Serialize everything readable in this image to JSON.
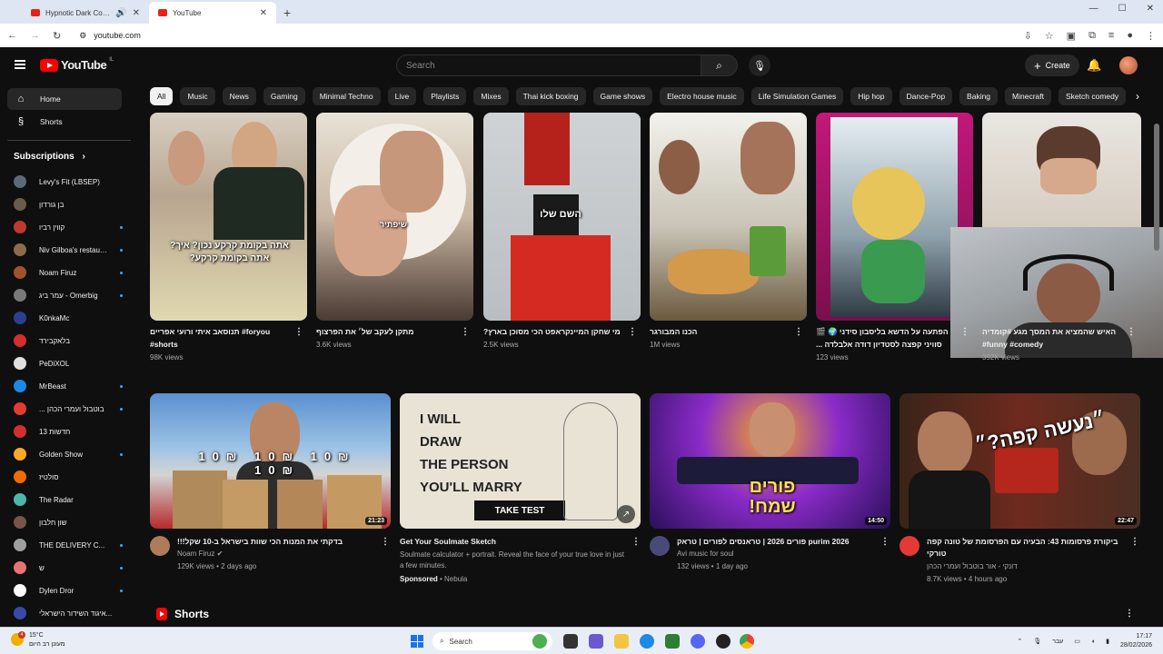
{
  "browser": {
    "tabs": [
      {
        "title": "Hypnotic Dark Code | Futur",
        "active": false
      },
      {
        "title": "YouTube",
        "active": true
      }
    ],
    "new_tab": "+",
    "url": "youtube.com"
  },
  "masthead": {
    "logo_text": "YouTube",
    "country_code": "IL",
    "search_placeholder": "Search",
    "create_label": "Create"
  },
  "sidebar": {
    "primary": [
      {
        "label": "Home",
        "icon": "home-icon"
      },
      {
        "label": "Shorts",
        "icon": "shorts-icon"
      }
    ],
    "subscriptions_title": "Subscriptions",
    "subscriptions": [
      {
        "name": "Levy's Fit (LBSEP)",
        "color": "#5a6a7a",
        "new": false
      },
      {
        "name": "בן גורדון",
        "color": "#6b5b4b",
        "new": false
      },
      {
        "name": "קווין רביו",
        "color": "#c0392b",
        "new": true
      },
      {
        "name": "Niv Gilboa's restaur...",
        "color": "#8e6b4b",
        "new": true
      },
      {
        "name": "Noam Firuz",
        "color": "#a0522d",
        "new": true
      },
      {
        "name": "עמר ביג - Omerbig",
        "color": "#7a7a7a",
        "new": true
      },
      {
        "name": "K0nkaMc",
        "color": "#2c3e8f",
        "new": false
      },
      {
        "name": "בלאקבירד",
        "color": "#d32f2f",
        "new": false
      },
      {
        "name": "PeDiXOL",
        "color": "#e0e0e0",
        "new": false
      },
      {
        "name": "MrBeast",
        "color": "#1e88e5",
        "new": true
      },
      {
        "name": "... בוטבול ועמרי הכהן",
        "color": "#e53935",
        "new": true
      },
      {
        "name": "חדשות 13",
        "color": "#d32f2f",
        "new": false
      },
      {
        "name": "Golden Show",
        "color": "#f9a825",
        "new": true
      },
      {
        "name": "סולטיז",
        "color": "#ef6c00",
        "new": false
      },
      {
        "name": "The Radar",
        "color": "#4db6ac",
        "new": false
      },
      {
        "name": "שון חלבון",
        "color": "#795548",
        "new": false
      },
      {
        "name": "THE DELIVERY C...",
        "color": "#9e9e9e",
        "new": true
      },
      {
        "name": "ש",
        "color": "#e57373",
        "new": true
      },
      {
        "name": "Dylen Dror",
        "color": "#fafafa",
        "new": true
      },
      {
        "name": "איגוד השידור הישראלי...",
        "color": "#3949ab",
        "new": false
      }
    ]
  },
  "chips": [
    "All",
    "Music",
    "News",
    "Gaming",
    "Minimal Techno",
    "Live",
    "Playlists",
    "Mixes",
    "Thai kick boxing",
    "Game shows",
    "Electro house music",
    "Life Simulation Games",
    "Hip hop",
    "Dance-Pop",
    "Baking",
    "Minecraft",
    "Sketch comedy"
  ],
  "shorts_row": [
    {
      "title": "תנוסאב איתי ורועי אפריים #foryou",
      "title2": "#shorts",
      "views": "98K views",
      "overlay": "אתה בקומת קרקע נכון? איך?\nאתה בקומת קרקע?"
    },
    {
      "title": "מתקן לעקב של׳ את הפרצוף",
      "title2": "",
      "views": "3.6K views",
      "overlay": "שיפתיר"
    },
    {
      "title": "?מי שחקן המיינקראפט הכי מסוכן בארץ",
      "title2": "",
      "views": "2.5K views",
      "overlay": "השם שלו"
    },
    {
      "title": "הכנו המבורגר",
      "title2": "",
      "views": "1M views",
      "overlay": ""
    },
    {
      "title": "🎬 🌍 הפתעה על הדשא בליסבון סידני",
      "title2": "... סוויני קפצה לסטדיון דודה אלבלדה",
      "views": "123 views",
      "overlay": ""
    },
    {
      "title": "האיש שהמציא את המסך מגע #קומדיה",
      "title2": "#funny #comedy",
      "views": "392K views",
      "overlay": ""
    }
  ],
  "videos": [
    {
      "title": "!!!בדקתי את המנות הכי שוות בישראל ב-10 שקל",
      "title2": "",
      "channel": "Noam Firuz",
      "verified": "✔",
      "meta": "129K views • 2 days ago",
      "duration": "21:23",
      "overlay": "10₪ 10₪ 10₪ 10₪"
    },
    {
      "title": "Get Your Soulmate Sketch",
      "title2": "",
      "channel": "",
      "desc": "Soulmate calculator + portrait. Reveal the face of your true love in just a few minutes.",
      "sponsored": "Sponsored",
      "advertiser": "Nebula",
      "overlay": "I WILL\nDRAW\nTHE PERSON\nYOU'LL MARRY",
      "cta": "TAKE TEST"
    },
    {
      "title": "פורים 2026 | טראנסים לפורים | טראק purim 2026",
      "title2": "",
      "channel": "Avi music for soul",
      "meta": "132 views • 1 day ago",
      "duration": "14:50",
      "overlay": "פורים\nשמח!"
    },
    {
      "title": "ביקורת פרסומות 43: הבעיה עם הפרסומת של טונה קפה",
      "title2": "טורקי",
      "channel": "דונקי - אור בוטבול ועמרי הכהן",
      "meta": "8.7K views • 4 hours ago",
      "duration": "22:47",
      "overlay": "״נעשה קפה?״"
    }
  ],
  "shorts_section_title": "Shorts",
  "taskbar": {
    "temp": "15°C",
    "weather_text": "מעונן רב היום",
    "badge": "4",
    "search_label": "Search",
    "lang": "עבר",
    "time": "17:17",
    "date": "28/02/2026"
  }
}
